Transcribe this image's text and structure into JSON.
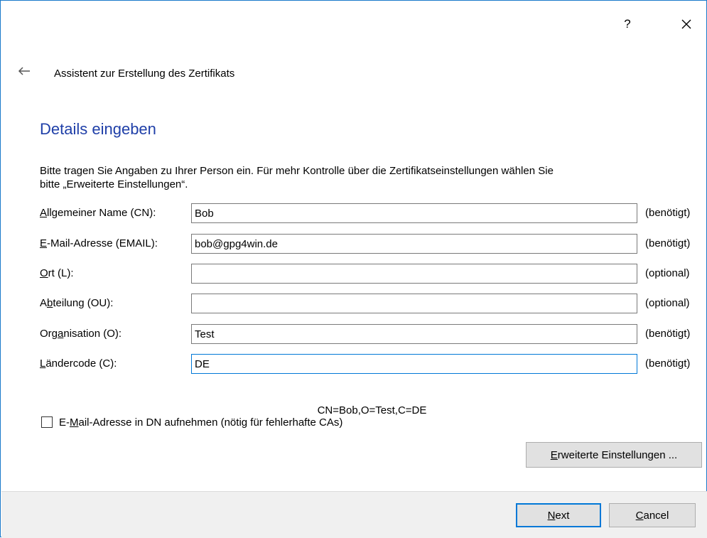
{
  "titlebar": {
    "help_label": "?",
    "close_label": "×"
  },
  "wizard": {
    "title": "Assistent zur Erstellung des Zertifikats"
  },
  "page": {
    "title": "Details eingeben",
    "description_line1": "Bitte tragen Sie Angaben zu Ihrer Person ein. Für mehr Kontrolle über die Zertifikatseinstellungen wählen Sie",
    "description_line2": "bitte „Erweiterte Einstellungen“."
  },
  "fields": [
    {
      "label_pre": "",
      "label_key": "A",
      "label_post": "llgemeiner Name (CN):",
      "value": "Bob",
      "hint": "(benötigt)"
    },
    {
      "label_pre": "",
      "label_key": "E",
      "label_post": "-Mail-Adresse (EMAIL):",
      "value": "bob@gpg4win.de",
      "hint": "(benötigt)"
    },
    {
      "label_pre": "",
      "label_key": "O",
      "label_post": "rt (L):",
      "value": "",
      "hint": "(optional)"
    },
    {
      "label_pre": "A",
      "label_key": "b",
      "label_post": "teilung (OU):",
      "value": "",
      "hint": "(optional)"
    },
    {
      "label_pre": "Org",
      "label_key": "a",
      "label_post": "nisation (O):",
      "value": "Test",
      "hint": "(benötigt)"
    },
    {
      "label_pre": "",
      "label_key": "L",
      "label_post": "ändercode (C):",
      "value": "DE",
      "hint": "(benötigt)"
    }
  ],
  "dn_preview": "CN=Bob,O=Test,C=DE",
  "email_in_dn": {
    "checked": false,
    "label_pre": "E-",
    "label_key": "M",
    "label_post": "ail-Adresse in DN aufnehmen (nötig für fehlerhafte CAs)"
  },
  "advanced_button": {
    "label_key": "E",
    "label_post": "rweiterte Einstellungen ..."
  },
  "footer": {
    "next_key": "N",
    "next_post": "ext",
    "cancel_key": "C",
    "cancel_post": "ancel"
  },
  "icons": {
    "back": "arrow-left-icon",
    "close": "close-icon",
    "checkbox": "checkbox-unchecked-icon"
  },
  "colors": {
    "title_blue": "#1f3fa8",
    "frame_border": "#1979ca",
    "focus_border": "#0078d7"
  }
}
